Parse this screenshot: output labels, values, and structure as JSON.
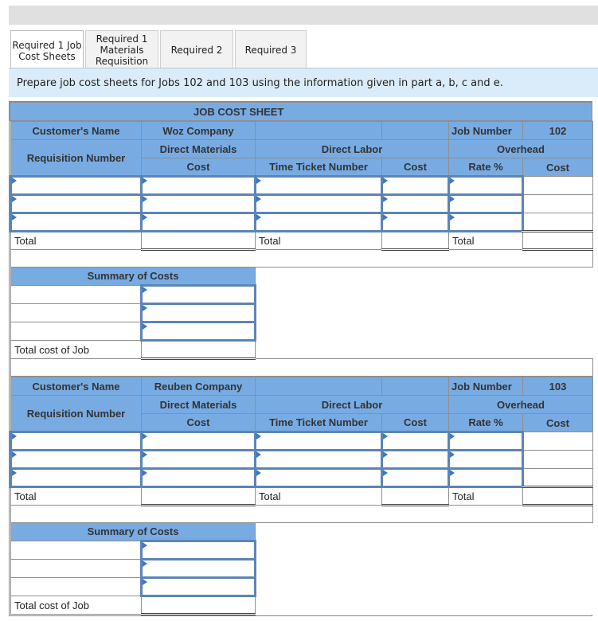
{
  "tabs": [
    {
      "label_lines": [
        "Required 1 Job",
        "Cost Sheets"
      ],
      "active": true
    },
    {
      "label_lines": [
        "Required 1",
        "Materials",
        "Requisition"
      ],
      "active": false
    },
    {
      "label_lines": [
        "Required 2"
      ],
      "active": false
    },
    {
      "label_lines": [
        "Required 3"
      ],
      "active": false
    }
  ],
  "instruction": "Prepare job cost sheets for Jobs 102 and 103 using the information given in part a, b, c and e.",
  "sheet_title": "JOB COST SHEET",
  "labels": {
    "customers_name": "Customer's Name",
    "job_number": "Job Number",
    "requisition_number": "Requisition Number",
    "direct_materials": "Direct Materials",
    "direct_labor": "Direct Labor",
    "overhead": "Overhead",
    "cost": "Cost",
    "time_ticket_number": "Time Ticket Number",
    "rate_pct": "Rate %",
    "total": "Total",
    "summary_of_costs": "Summary of Costs",
    "total_cost_of_job": "Total cost of Job"
  },
  "jobs": [
    {
      "customer": "Woz Company",
      "job_number": "102"
    },
    {
      "customer": "Reuben Company",
      "job_number": "103"
    }
  ]
}
